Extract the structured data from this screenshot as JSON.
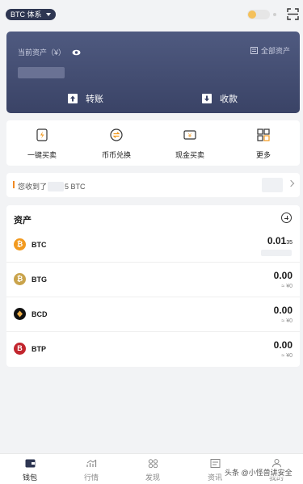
{
  "header": {
    "network_label": "BTC 体系"
  },
  "wallet_card": {
    "balance_label": "当前资产（¥）",
    "all_assets_label": "全部资产",
    "transfer_label": "转账",
    "receive_label": "收款"
  },
  "quick_actions": [
    {
      "label": "一键买卖",
      "icon": "lightning-icon"
    },
    {
      "label": "币币兑换",
      "icon": "swap-icon"
    },
    {
      "label": "现金买卖",
      "icon": "cash-icon"
    },
    {
      "label": "更多",
      "icon": "grid-icon"
    }
  ],
  "notice": {
    "prefix": "您收到了",
    "suffix": "5 BTC"
  },
  "assets": {
    "title": "资产",
    "items": [
      {
        "symbol": "BTC",
        "amount": "0.01",
        "amount_tail": "35",
        "fiat": "",
        "color": "#f29a1f"
      },
      {
        "symbol": "BTG",
        "amount": "0.00",
        "amount_tail": "",
        "fiat": "≈ ¥0",
        "color": "#c9a34b"
      },
      {
        "symbol": "BCD",
        "amount": "0.00",
        "amount_tail": "",
        "fiat": "≈ ¥0",
        "color": "#111111"
      },
      {
        "symbol": "BTP",
        "amount": "0.00",
        "amount_tail": "",
        "fiat": "≈ ¥0",
        "color": "#c2262e"
      }
    ]
  },
  "tabbar": [
    {
      "label": "钱包",
      "active": true
    },
    {
      "label": "行情",
      "active": false
    },
    {
      "label": "发现",
      "active": false
    },
    {
      "label": "资讯",
      "active": false
    },
    {
      "label": "我的",
      "active": false
    }
  ],
  "watermark": "头条 @小怪兽讲安全"
}
